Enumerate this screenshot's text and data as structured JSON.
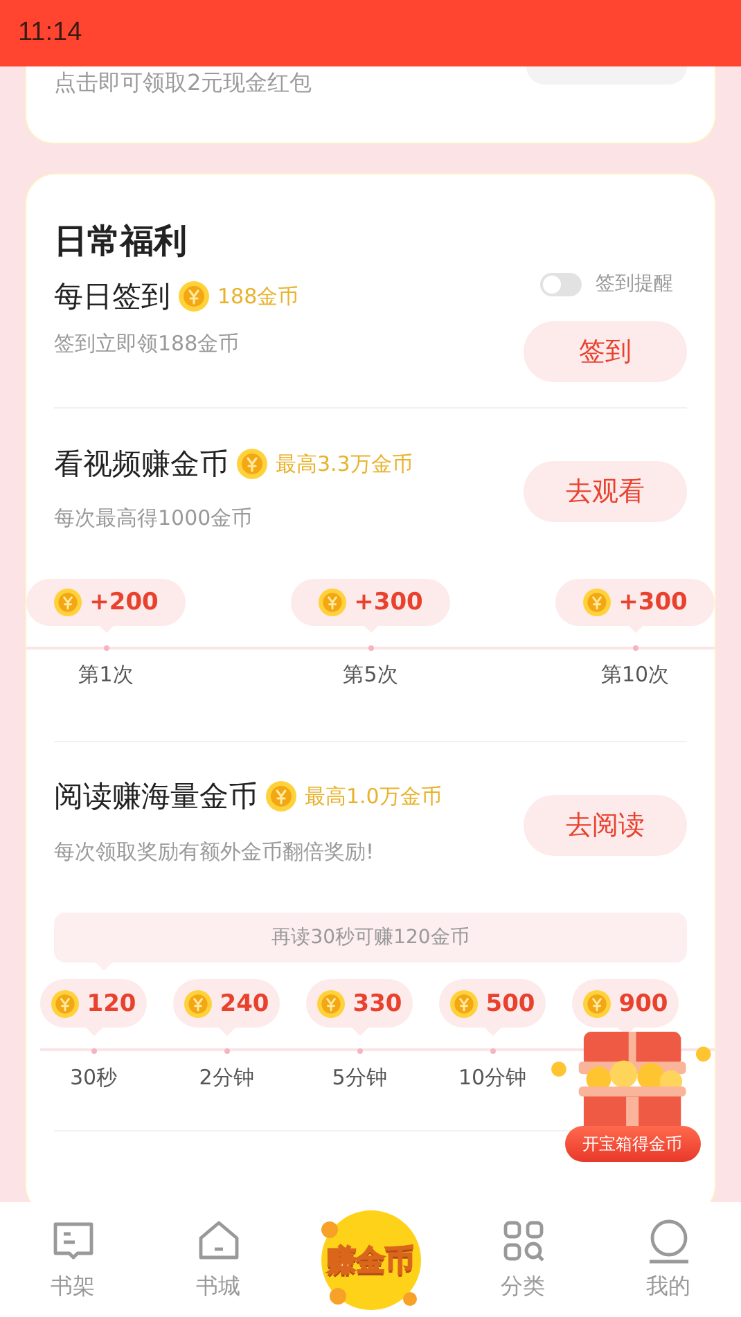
{
  "status_bar": {
    "time": "11:14"
  },
  "cash_card": {
    "text": "点击即可领取2元现金红包"
  },
  "daily": {
    "title": "日常福利",
    "sign_in": {
      "title": "每日签到",
      "reward": "188金币",
      "subtitle": "签到立即领188金币",
      "reminder": {
        "label": "签到提醒",
        "on": false
      },
      "button": "签到"
    },
    "video": {
      "title": "看视频赚金币",
      "reward": "最高3.3万金币",
      "subtitle": "每次最高得1000金币",
      "button": "去观看",
      "milestones": [
        {
          "amount": "+200",
          "label": "第1次"
        },
        {
          "amount": "+300",
          "label": "第5次"
        },
        {
          "amount": "+300",
          "label": "第10次"
        }
      ]
    },
    "reading": {
      "title": "阅读赚海量金币",
      "reward": "最高1.0万金币",
      "subtitle": "每次领取奖励有额外金币翻倍奖励!",
      "button": "去阅读",
      "hint": "再读30秒可赚120金币",
      "tiers": [
        {
          "amount": "120",
          "label": "30秒"
        },
        {
          "amount": "240",
          "label": "2分钟"
        },
        {
          "amount": "330",
          "label": "5分钟"
        },
        {
          "amount": "500",
          "label": "10分钟"
        },
        {
          "amount": "900"
        }
      ]
    },
    "chest": {
      "button": "开宝箱得金币"
    }
  },
  "tabs": [
    {
      "kind": "book",
      "label": "书架",
      "selected": false
    },
    {
      "kind": "home",
      "label": "书城",
      "selected": false
    },
    {
      "kind": "logo",
      "label": "赚金币",
      "selected": true
    },
    {
      "kind": "grid",
      "label": "分类",
      "selected": false
    },
    {
      "kind": "user",
      "label": "我的",
      "selected": false
    }
  ]
}
